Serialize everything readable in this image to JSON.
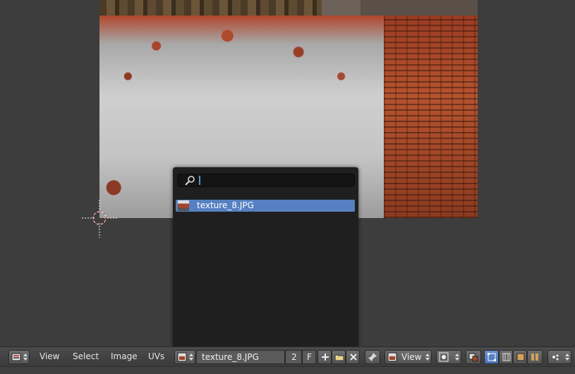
{
  "editor": {
    "popup": {
      "search_value": "",
      "results": [
        {
          "label": "texture_8.JPG",
          "thumb": "image-thumbnail-icon",
          "selected": true
        }
      ]
    },
    "header": {
      "editor_type_icon": "uv-image-editor-icon",
      "menus": [
        "View",
        "Select",
        "Image",
        "UVs"
      ],
      "image_browse_icon": "image-browse-icon",
      "image_name": "texture_8.JPG",
      "users": "2",
      "fake_user": "F",
      "new_icon": "plus-icon",
      "open_icon": "folder-icon",
      "unlink_icon": "close-icon",
      "pin_icon": "pin-icon",
      "mode_icon": "view-mode-icon",
      "mode_label": "View",
      "pivot_icon": "pivot-icon",
      "sync_icon": "sticky-selection-icon",
      "select_mode_icons": [
        "vertex-select-icon",
        "edge-select-icon",
        "face-select-icon",
        "island-select-icon"
      ],
      "snap_icon": "snap-icon"
    },
    "colors": {
      "background": "#3d3d3d",
      "popup": "#1f1f1f",
      "selection": "#5680c2",
      "header": "#474747"
    }
  }
}
